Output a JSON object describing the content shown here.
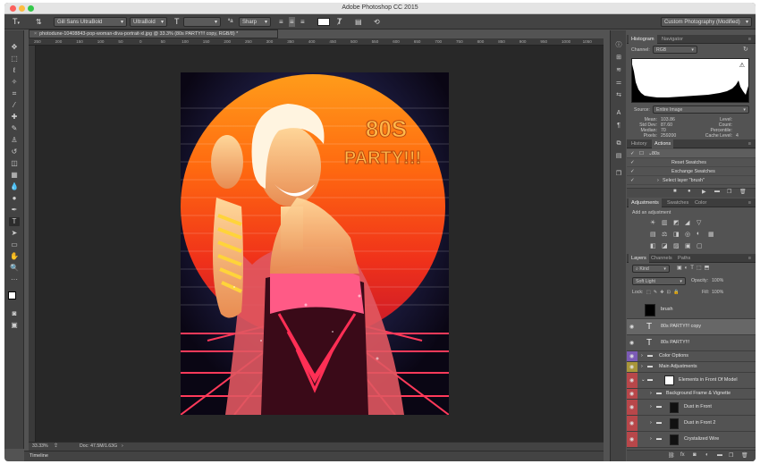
{
  "app": {
    "title": "Adobe Photoshop CC 2015"
  },
  "options": {
    "font_family": "Gill Sans UltraBold",
    "font_style": "UltraBold",
    "anti_alias": "Sharp",
    "workspace": "Custom Photography (Modified)"
  },
  "document": {
    "tab": "photodune-10408843-pop-woman-diva-portrait-xl.jpg @ 33.3% (80s  PARTY!!! copy, RGB/8) *",
    "zoom": "33.33%",
    "doc_size": "Doc: 47.5M/1.63G"
  },
  "ruler": {
    "ticks": [
      "250",
      "200",
      "150",
      "100",
      "50",
      "0",
      "50",
      "100",
      "150",
      "200",
      "250",
      "300",
      "350",
      "400",
      "450",
      "500",
      "550",
      "600",
      "650",
      "700",
      "750",
      "800",
      "850",
      "900",
      "950",
      "1000",
      "1050"
    ]
  },
  "artwork": {
    "line1": "80S",
    "line2": "PARTY!!!"
  },
  "histogram": {
    "tabs": [
      "Histogram",
      "Navigator"
    ],
    "channel_label": "Channel:",
    "channel": "RGB",
    "source_label": "Source:",
    "source": "Entire Image",
    "stats_left": [
      [
        "Mean:",
        "103.86"
      ],
      [
        "Std Dev:",
        "87.60"
      ],
      [
        "Median:",
        "70"
      ],
      [
        "Pixels:",
        "259200"
      ]
    ],
    "stats_right": [
      [
        "Level:",
        ""
      ],
      [
        "Count:",
        ""
      ],
      [
        "Percentile:",
        ""
      ],
      [
        "Cache Level:",
        "4"
      ]
    ]
  },
  "history": {
    "tabs": [
      "History",
      "Actions"
    ],
    "items": [
      "80s",
      "Reset Swatches",
      "Exchange Swatches",
      "Select layer \"brush\""
    ]
  },
  "adjustments": {
    "tabs": [
      "Adjustments",
      "Swatches",
      "Color"
    ],
    "hint": "Add an adjustment"
  },
  "layers": {
    "tabs": [
      "Layers",
      "Channels",
      "Paths"
    ],
    "kind": "Kind",
    "blend": "Soft Light",
    "opacity_label": "Opacity:",
    "opacity": "100%",
    "lock_label": "Lock:",
    "fill_label": "Fill:",
    "fill": "100%",
    "items": [
      {
        "name": "brush",
        "type": "mask"
      },
      {
        "name": "80s  PARTY!!! copy",
        "type": "text"
      },
      {
        "name": "80s  PARTY!!!",
        "type": "text"
      },
      {
        "name": "Color Options",
        "type": "group"
      },
      {
        "name": "Main Adjustments",
        "type": "group"
      },
      {
        "name": "Elements in Front Of Model",
        "type": "group"
      },
      {
        "name": "Background Frame & Vignette",
        "type": "group"
      },
      {
        "name": "Dust in Front",
        "type": "layer"
      },
      {
        "name": "Dust in Front 2",
        "type": "layer"
      },
      {
        "name": "Crystalized Wire",
        "type": "layer"
      }
    ]
  },
  "status": {
    "timeline": "Timeline"
  },
  "colors": {
    "accent_red": "#b8474a",
    "accent_purple": "#7b5bb5",
    "accent_olive": "#a8953a",
    "selected_row": "#676767"
  }
}
